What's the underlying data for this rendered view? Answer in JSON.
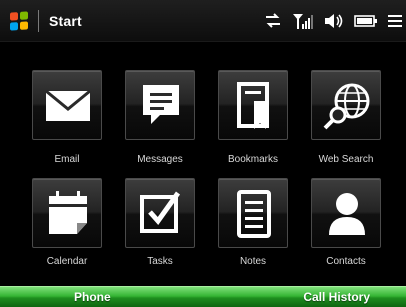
{
  "topbar": {
    "start_label": "Start",
    "logo_colors": [
      "#f25022",
      "#7fba00",
      "#00a4ef",
      "#ffb900"
    ],
    "status_icons": [
      "connectivity-icon",
      "signal-icon",
      "volume-icon",
      "battery-icon",
      "menu-icon"
    ]
  },
  "tiles": [
    {
      "label": "Email",
      "icon": "envelope-icon"
    },
    {
      "label": "Messages",
      "icon": "speech-bubble-icon"
    },
    {
      "label": "Bookmarks",
      "icon": "bookmark-icon"
    },
    {
      "label": "Web Search",
      "icon": "globe-search-icon"
    },
    {
      "label": "Calendar",
      "icon": "calendar-icon"
    },
    {
      "label": "Tasks",
      "icon": "checkbox-icon"
    },
    {
      "label": "Notes",
      "icon": "notes-icon"
    },
    {
      "label": "Contacts",
      "icon": "person-icon"
    }
  ],
  "softkeys": {
    "left": "Phone",
    "right": "Call History"
  },
  "colors": {
    "softkey_bar": "#35b534",
    "background": "#000000"
  }
}
